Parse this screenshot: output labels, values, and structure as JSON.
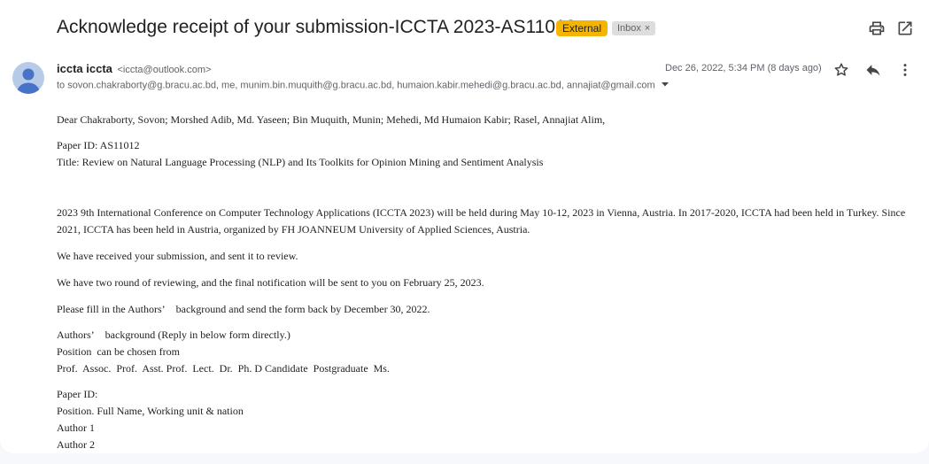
{
  "email": {
    "subject": "Acknowledge receipt of your submission-ICCTA 2023-AS11012",
    "labels": {
      "external": "External",
      "inbox": "Inbox",
      "remove": "×"
    },
    "sender_name": "iccta iccta",
    "sender_email": "<iccta@outlook.com>",
    "recipients": "to sovon.chakraborty@g.bracu.ac.bd, me, munim.bin.muquith@g.bracu.ac.bd, humaion.kabir.mehedi@g.bracu.ac.bd, annajiat@gmail.com",
    "date": "Dec 26, 2022, 5:34 PM (8 days ago)"
  },
  "icons": {
    "print": "print-icon",
    "open_new_window": "open-in-new-icon",
    "star": "star-icon",
    "reply": "reply-icon",
    "more": "more-vert-icon",
    "avatar": "person-icon",
    "details": "caret-down-icon"
  },
  "body": {
    "greeting": "Dear Chakraborty, Sovon; Morshed Adib, Md. Yaseen; Bin Muquith, Munin; Mehedi, Md Humaion Kabir; Rasel, Annajiat Alim,",
    "paper_id": "Paper ID: AS11012",
    "title": "Title: Review on Natural Language Processing (NLP) and Its Toolkits for Opinion Mining and Sentiment Analysis",
    "conference": "2023 9th International Conference on Computer Technology Applications (ICCTA 2023) will be held during May 10-12, 2023 in Vienna, Austria. In 2017-2020, ICCTA had been held in Turkey. Since 2021, ICCTA has been held in Austria, organized by FH JOANNEUM University of Applied Sciences, Austria.",
    "received": "We have received your submission, and sent it to review.",
    "reviewing": "We have two round of reviewing, and the final notification will be sent to you on February 25, 2023.",
    "fill_in": "Please fill in the Authors’    background and send the form back by December 30, 2022.",
    "authors_bg": "Authors’    background (Reply in below form directly.)",
    "position_choose": "Position  can be chosen from",
    "positions": "Prof.  Assoc.  Prof.  Asst. Prof.  Lect.  Dr.  Ph. D Candidate  Postgraduate  Ms.",
    "form_paper_id": "Paper ID:",
    "form_position": "Position. Full Name, Working unit & nation",
    "author1": "Author 1",
    "author2": "Author 2"
  }
}
